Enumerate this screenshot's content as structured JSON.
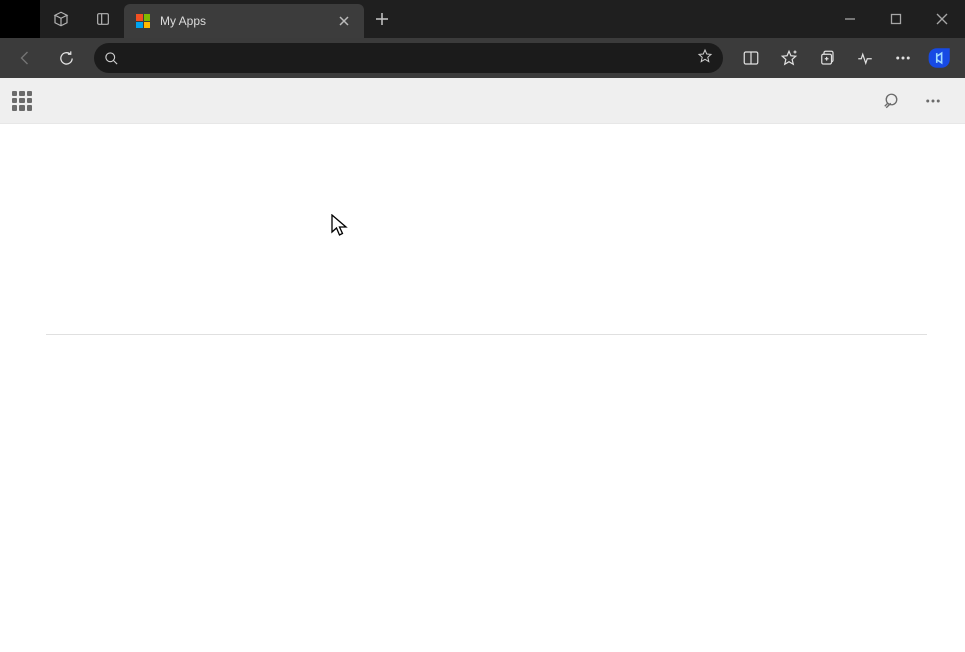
{
  "tab": {
    "title": "My Apps"
  }
}
